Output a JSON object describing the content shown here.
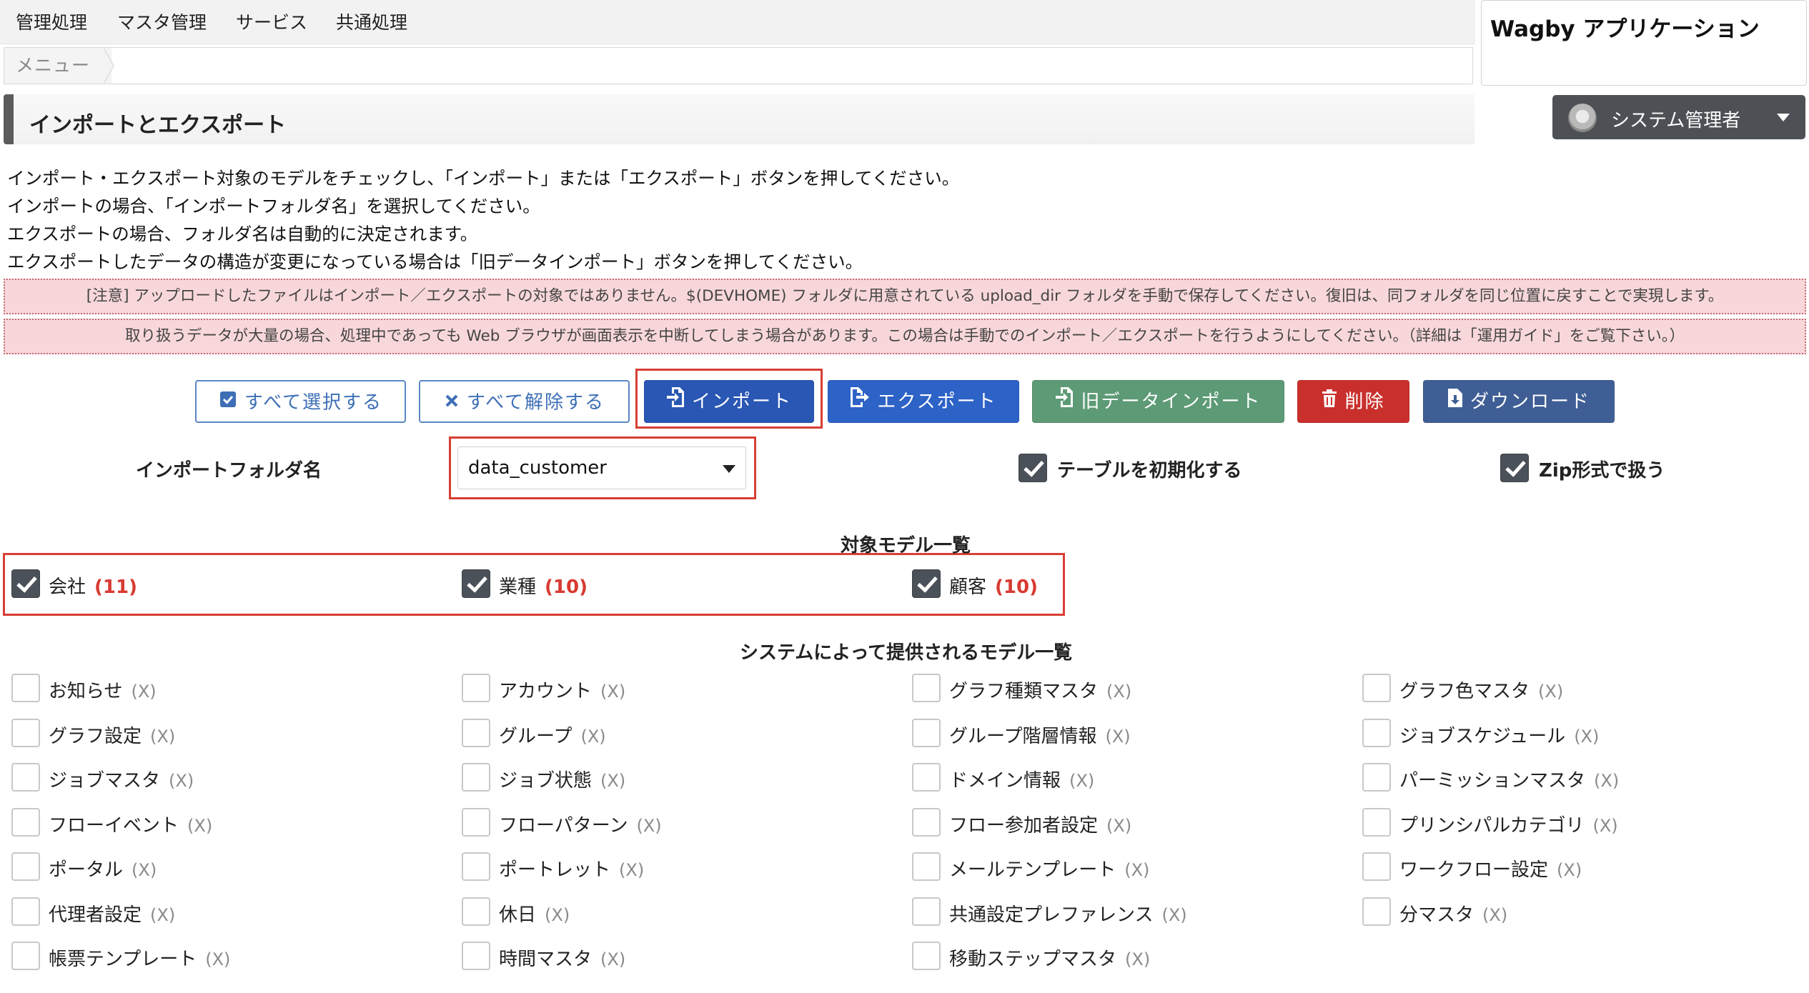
{
  "menubar": {
    "items": [
      "管理処理",
      "マスタ管理",
      "サービス",
      "共通処理"
    ]
  },
  "breadcrumb": {
    "menu": "メニュー"
  },
  "app": {
    "title": "Wagby アプリケーション"
  },
  "page": {
    "title": "インポートとエクスポート"
  },
  "user": {
    "label": "システム管理者"
  },
  "description": [
    "インポート・エクスポート対象のモデルをチェックし、「インポート」または「エクスポート」ボタンを押してください。",
    "インポートの場合、「インポートフォルダ名」を選択してください。",
    "エクスポートの場合、フォルダ名は自動的に決定されます。",
    "エクスポートしたデータの構造が変更になっている場合は「旧データインポート」ボタンを押してください。"
  ],
  "notices": [
    "[注意] アップロードしたファイルはインポート／エクスポートの対象ではありません。$(DEVHOME) フォルダに用意されている upload_dir フォルダを手動で保存してください。復旧は、同フォルダを同じ位置に戻すことで実現します。",
    "取り扱うデータが大量の場合、処理中であっても Web ブラウザが画面表示を中断してしまう場合があります。この場合は手動でのインポート／エクスポートを行うようにしてください。（詳細は「運用ガイド」をご覧下さい。）"
  ],
  "buttons": {
    "select_all": "すべて選択する",
    "deselect_all": "すべて解除する",
    "import": "インポート",
    "export": "エクスポート",
    "old_import": "旧データインポート",
    "delete": "削除",
    "download": "ダウンロード"
  },
  "colors": {
    "import": "#2a57b4",
    "export": "#2d62c6",
    "old_import": "#5d9a76",
    "delete": "#c9302c",
    "download": "#3f5e95",
    "highlight": "#d83e34"
  },
  "folder": {
    "label": "インポートフォルダ名",
    "selected": "data_customer"
  },
  "options": {
    "init_table": {
      "label": "テーブルを初期化する",
      "checked": true
    },
    "zip": {
      "label": "Zip形式で扱う",
      "checked": true
    }
  },
  "target_models": {
    "title": "対象モデル一覧",
    "items": [
      {
        "name": "会社",
        "count": "(11)",
        "checked": true
      },
      {
        "name": "業種",
        "count": "(10)",
        "checked": true
      },
      {
        "name": "顧客",
        "count": "(10)",
        "checked": true
      }
    ]
  },
  "system_models": {
    "title": "システムによって提供されるモデル一覧",
    "items": [
      {
        "name": "お知らせ",
        "count": "(X)"
      },
      {
        "name": "アカウント",
        "count": "(X)"
      },
      {
        "name": "グラフ種類マスタ",
        "count": "(X)"
      },
      {
        "name": "グラフ色マスタ",
        "count": "(X)"
      },
      {
        "name": "グラフ設定",
        "count": "(X)"
      },
      {
        "name": "グループ",
        "count": "(X)"
      },
      {
        "name": "グループ階層情報",
        "count": "(X)"
      },
      {
        "name": "ジョブスケジュール",
        "count": "(X)"
      },
      {
        "name": "ジョブマスタ",
        "count": "(X)"
      },
      {
        "name": "ジョブ状態",
        "count": "(X)"
      },
      {
        "name": "ドメイン情報",
        "count": "(X)"
      },
      {
        "name": "パーミッションマスタ",
        "count": "(X)"
      },
      {
        "name": "フローイベント",
        "count": "(X)"
      },
      {
        "name": "フローパターン",
        "count": "(X)"
      },
      {
        "name": "フロー参加者設定",
        "count": "(X)"
      },
      {
        "name": "プリンシパルカテゴリ",
        "count": "(X)"
      },
      {
        "name": "ポータル",
        "count": "(X)"
      },
      {
        "name": "ポートレット",
        "count": "(X)"
      },
      {
        "name": "メールテンプレート",
        "count": "(X)"
      },
      {
        "name": "ワークフロー設定",
        "count": "(X)"
      },
      {
        "name": "代理者設定",
        "count": "(X)"
      },
      {
        "name": "休日",
        "count": "(X)"
      },
      {
        "name": "共通設定プレファレンス",
        "count": "(X)"
      },
      {
        "name": "分マスタ",
        "count": "(X)"
      },
      {
        "name": "帳票テンプレート",
        "count": "(X)"
      },
      {
        "name": "時間マスタ",
        "count": "(X)"
      },
      {
        "name": "移動ステップマスタ",
        "count": "(X)"
      }
    ]
  }
}
